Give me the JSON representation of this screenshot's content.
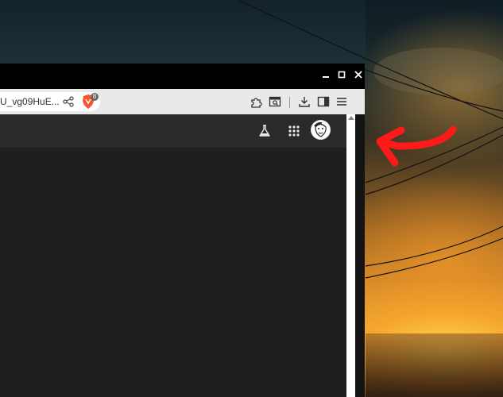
{
  "browser": {
    "window_controls": {
      "minimize": "▬",
      "maximize": "◻",
      "close": "✕"
    },
    "toolbar": {
      "url_fragment": "U_vg09HuE...",
      "brave_shield_count": "8",
      "icons": [
        "share-icon",
        "brave-shield-icon",
        "extensions-icon",
        "tab-search-icon",
        "download-icon",
        "sidebar-icon",
        "menu-icon"
      ]
    },
    "header_icons": [
      "labs-flask-icon",
      "apps-grid-icon",
      "avatar"
    ]
  },
  "annotation": {
    "color": "#ff1a1a",
    "shape": "arrow-pointing-left"
  },
  "colors": {
    "titlebar": "#000000",
    "toolbar": "#e9e9e9",
    "page_header": "#2a2a2c",
    "page_body": "#1f1f1f"
  }
}
